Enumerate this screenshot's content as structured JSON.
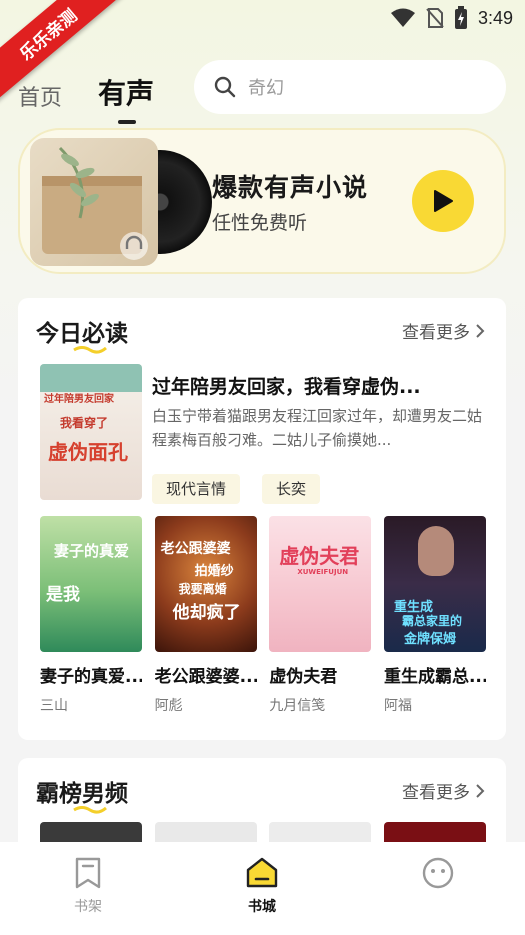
{
  "watermark": "乐乐亲测",
  "status": {
    "time": "3:49"
  },
  "nav": {
    "tabs": [
      "首页",
      "有声"
    ]
  },
  "search": {
    "placeholder": "奇幻"
  },
  "banner": {
    "title": "爆款有声小说",
    "subtitle": "任性免费听"
  },
  "today": {
    "title": "今日必读",
    "more": "查看更多",
    "featured": {
      "title": "过年陪男友回家，我看穿虚伪...",
      "desc": "白玉宁带着猫跟男友程江回家过年，却遭男友二姑程素梅百般刁难。二姑儿子偷摸她...",
      "tags": [
        "现代言情",
        "长奕"
      ],
      "cover_text": [
        "过年陪男友回家",
        "我看穿了",
        "虚伪面孔"
      ]
    },
    "books": [
      {
        "title": "妻子的真爱...",
        "author": "三山",
        "cover_text": [
          "妻子的真爱",
          "是我"
        ]
      },
      {
        "title": "老公跟婆婆...",
        "author": "阿彪",
        "cover_text": [
          "老公跟婆婆",
          "拍婚纱",
          "我要离婚",
          "他却疯了"
        ]
      },
      {
        "title": "虚伪夫君",
        "author": "九月信笺",
        "cover_text": [
          "虚伪夫君",
          "XUWEIFUJUN"
        ]
      },
      {
        "title": "重生成霸总...",
        "author": "阿福",
        "cover_text": [
          "重生成",
          "霸总家里的",
          "金牌保姆"
        ]
      }
    ]
  },
  "ranking": {
    "title": "霸榜男频",
    "more": "查看更多"
  },
  "tabbar": {
    "items": [
      "书架",
      "书城",
      ""
    ]
  }
}
